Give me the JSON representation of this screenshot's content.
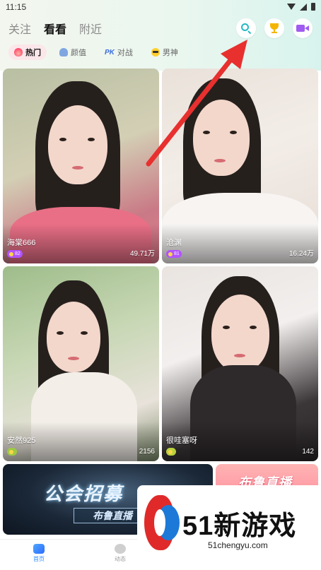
{
  "status_bar": {
    "time": "11:15"
  },
  "header": {
    "tabs": [
      {
        "label": "关注"
      },
      {
        "label": "看看"
      },
      {
        "label": "附近"
      }
    ],
    "active_tab": "看看",
    "actions": [
      {
        "icon": "search-icon",
        "color": "#26b8c4"
      },
      {
        "icon": "trophy-icon",
        "color": "#f5b400"
      },
      {
        "icon": "video-camera-icon",
        "color": "#a05cf0"
      }
    ]
  },
  "categories": [
    {
      "label": "热门",
      "icon": "flame-icon",
      "active": true
    },
    {
      "label": "颜值",
      "icon": "heart-icon"
    },
    {
      "label": "对战",
      "icon": "pk-icon",
      "icon_text": "PK"
    },
    {
      "label": "男神",
      "icon": "sunglasses-icon"
    }
  ],
  "cards": [
    {
      "name": "海棠666",
      "badge": "82",
      "badge_color": "#b153ff",
      "views": "49.71万"
    },
    {
      "name": "沧渊",
      "badge": "81",
      "badge_color": "#b153ff",
      "views": "16.24万"
    },
    {
      "name": "安然925",
      "badge": "",
      "badge_color": "#9dc944",
      "views": "2156"
    },
    {
      "name": "很哇塞呀",
      "badge": "",
      "badge_color": "#b8d23e",
      "views": "142"
    }
  ],
  "banners": {
    "left": {
      "title": "公会招募",
      "subtitle": "布鲁直播"
    },
    "right": {
      "title": "布鲁直播"
    }
  },
  "bottom_nav": [
    {
      "label": "首页",
      "icon": "home-icon",
      "active": true
    },
    {
      "label": "动态",
      "icon": "dynamic-icon"
    }
  ],
  "watermark": {
    "title": "51新游戏",
    "url": "51chengyu.com"
  },
  "colors": {
    "accent": "#2d8cff",
    "arrow": "#e8302f"
  }
}
